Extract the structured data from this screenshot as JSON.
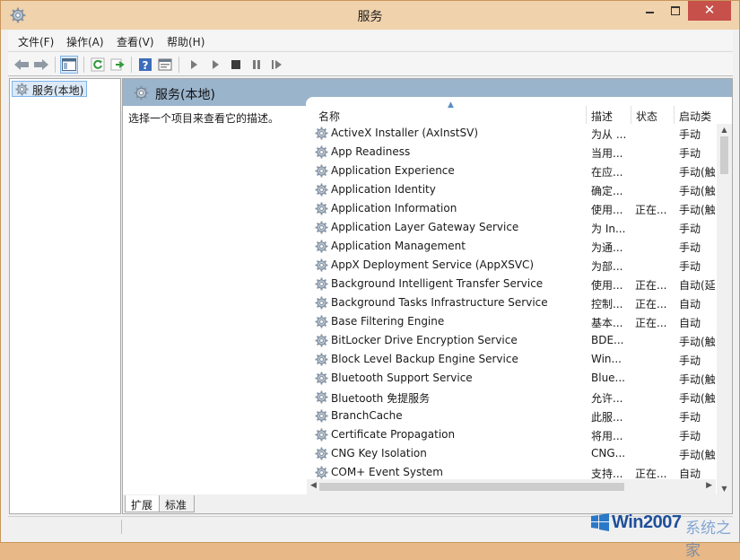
{
  "window": {
    "title": "服务"
  },
  "menu": [
    "文件(F)",
    "操作(A)",
    "查看(V)",
    "帮助(H)"
  ],
  "toolbar": {
    "icons": [
      "back-icon",
      "forward-icon",
      "show-hide-console-tree-icon",
      "refresh-icon",
      "export-list-icon",
      "help-icon",
      "properties-icon",
      "start-service-icon",
      "start-service-alt-icon",
      "stop-service-icon",
      "pause-service-icon",
      "restart-service-icon"
    ]
  },
  "tree": {
    "selected": "服务(本地)"
  },
  "panel": {
    "title": "服务(本地)",
    "description": "选择一个项目来查看它的描述。"
  },
  "columns": {
    "name": "名称",
    "desc": "描述",
    "status": "状态",
    "startup": "启动类"
  },
  "services": [
    {
      "name": "ActiveX Installer (AxInstSV)",
      "desc": "为从 ...",
      "status": "",
      "startup": "手动"
    },
    {
      "name": "App Readiness",
      "desc": "当用...",
      "status": "",
      "startup": "手动"
    },
    {
      "name": "Application Experience",
      "desc": "在应...",
      "status": "",
      "startup": "手动(触"
    },
    {
      "name": "Application Identity",
      "desc": "确定...",
      "status": "",
      "startup": "手动(触"
    },
    {
      "name": "Application Information",
      "desc": "使用...",
      "status": "正在...",
      "startup": "手动(触"
    },
    {
      "name": "Application Layer Gateway Service",
      "desc": "为 In...",
      "status": "",
      "startup": "手动"
    },
    {
      "name": "Application Management",
      "desc": "为通...",
      "status": "",
      "startup": "手动"
    },
    {
      "name": "AppX Deployment Service (AppXSVC)",
      "desc": "为部...",
      "status": "",
      "startup": "手动"
    },
    {
      "name": "Background Intelligent Transfer Service",
      "desc": "使用...",
      "status": "正在...",
      "startup": "自动(延"
    },
    {
      "name": "Background Tasks Infrastructure Service",
      "desc": "控制...",
      "status": "正在...",
      "startup": "自动"
    },
    {
      "name": "Base Filtering Engine",
      "desc": "基本...",
      "status": "正在...",
      "startup": "自动"
    },
    {
      "name": "BitLocker Drive Encryption Service",
      "desc": "BDE...",
      "status": "",
      "startup": "手动(触"
    },
    {
      "name": "Block Level Backup Engine Service",
      "desc": "Win...",
      "status": "",
      "startup": "手动"
    },
    {
      "name": "Bluetooth Support Service",
      "desc": "Blue...",
      "status": "",
      "startup": "手动(触"
    },
    {
      "name": "Bluetooth 免提服务",
      "desc": "允许...",
      "status": "",
      "startup": "手动(触"
    },
    {
      "name": "BranchCache",
      "desc": "此服...",
      "status": "",
      "startup": "手动"
    },
    {
      "name": "Certificate Propagation",
      "desc": "将用...",
      "status": "",
      "startup": "手动"
    },
    {
      "name": "CNG Key Isolation",
      "desc": "CNG...",
      "status": "",
      "startup": "手动(触"
    },
    {
      "name": "COM+ Event System",
      "desc": "支持...",
      "status": "正在...",
      "startup": "自动"
    }
  ],
  "tabs": [
    "扩展",
    "标准"
  ],
  "watermark": {
    "text": "Win2007",
    "suffix": "系统之家"
  }
}
